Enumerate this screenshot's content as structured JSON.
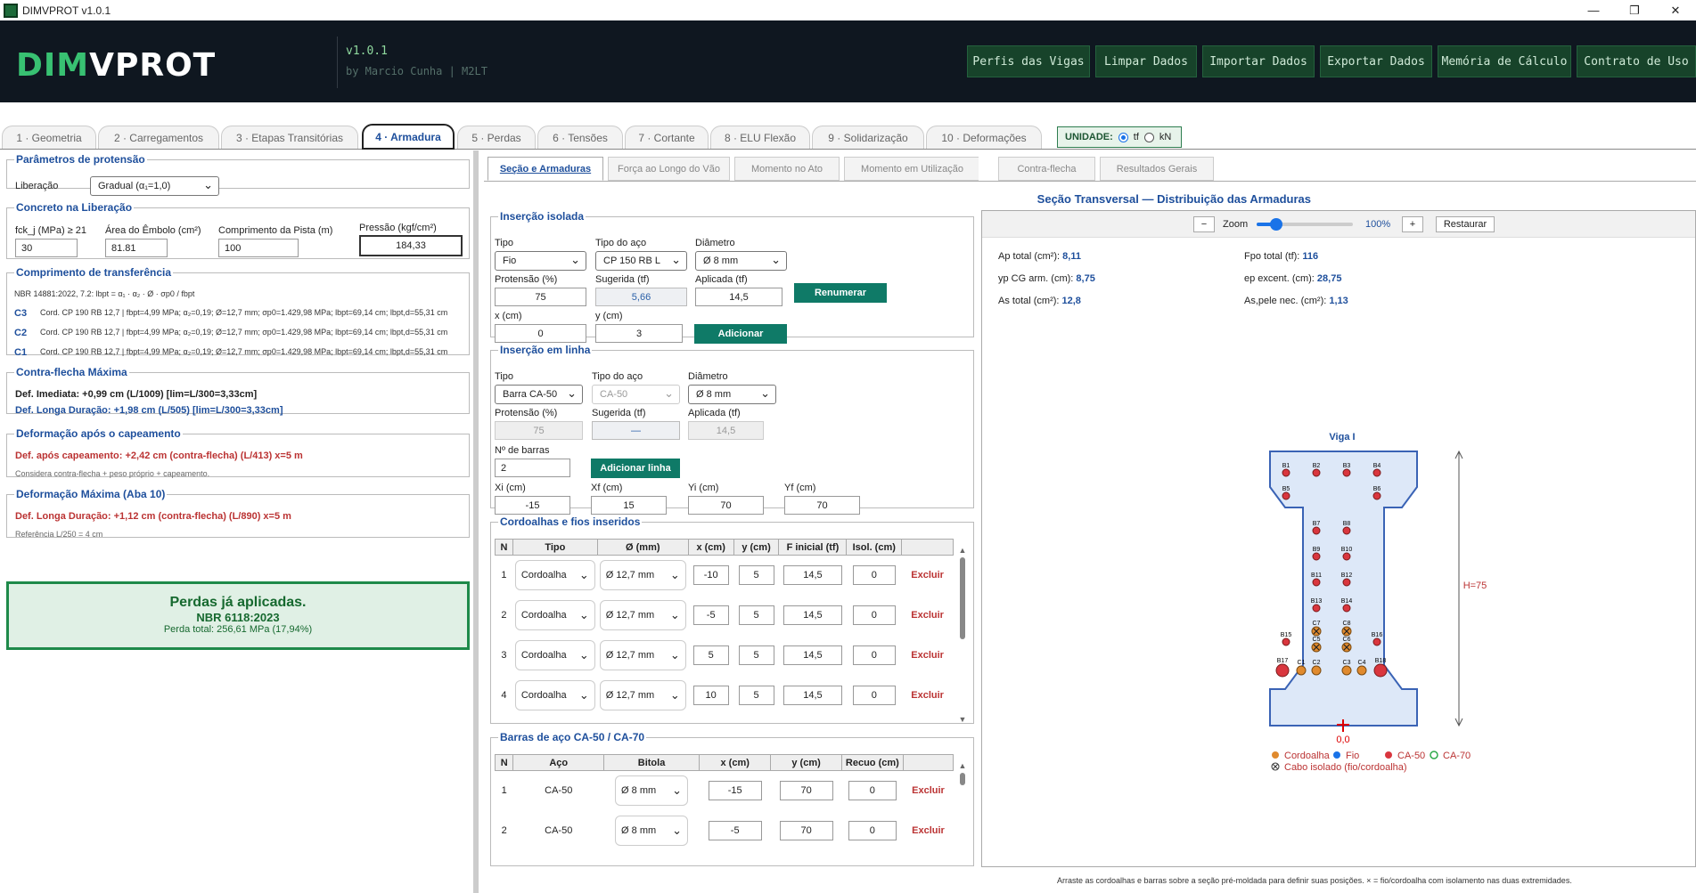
{
  "window": {
    "title": "DIMVPROT v1.0.1"
  },
  "header": {
    "logo_left": "DIM",
    "logo_right": "VPROT",
    "version": "v1.0.1",
    "byline": "by Marcio Cunha  |  M2LT",
    "buttons": [
      "Perfis das Vigas",
      "Limpar Dados",
      "Importar Dados",
      "Exportar Dados",
      "Memória de Cálculo",
      "Contrato de Uso"
    ]
  },
  "tabs": [
    "1 · Geometria",
    "2 · Carregamentos",
    "3 · Etapas Transitórias",
    "4 · Armadura",
    "5 · Perdas",
    "6 · Tensões",
    "7 · Cortante",
    "8 · ELU Flexão",
    "9 · Solidarização",
    "10 · Deformações"
  ],
  "unidade": {
    "label": "UNIDADE:",
    "opt1": "tf",
    "opt2": "kN"
  },
  "left": {
    "protensao": {
      "legend": "Parâmetros de protensão",
      "label": "Liberação",
      "value": "Gradual (α₁=1,0)"
    },
    "concreto": {
      "legend": "Concreto na Liberação",
      "fck_label": "fck_j (MPa) ≥ 21",
      "fck": "30",
      "area_label": "Área do Êmbolo (cm²)",
      "area": "81.81",
      "comp_label": "Comprimento da Pista (m)",
      "comp": "100",
      "pressao_label": "Pressão (kgf/cm²)",
      "pressao": "184,33"
    },
    "transfer": {
      "legend": "Comprimento de transferência",
      "norma": "NBR 14881:2022, 7.2: lbpt = α₁ · α₂ · Ø · σp0 / fbpt",
      "rows": [
        {
          "id": "C3",
          "text": "Cord. CP 190 RB 12,7 | fbpt=4,99 MPa; α₂=0,19; Ø=12,7 mm; σp0=1.429,98 MPa; lbpt=69,14 cm; lbpt,d=55,31 cm"
        },
        {
          "id": "C2",
          "text": "Cord. CP 190 RB 12,7 | fbpt=4,99 MPa; α₂=0,19; Ø=12,7 mm; σp0=1.429,98 MPa; lbpt=69,14 cm; lbpt,d=55,31 cm"
        },
        {
          "id": "C1",
          "text": "Cord. CP 190 RB 12,7 | fbpt=4,99 MPa; α₂=0,19; Ø=12,7 mm; σp0=1.429,98 MPa; lbpt=69,14 cm; lbpt,d=55,31 cm"
        }
      ]
    },
    "contraflecha": {
      "legend": "Contra-flecha Máxima",
      "line1": "Def. Imediata: +0,99 cm (L/1009) [lim=L/300=3,33cm]",
      "line2": "Def. Longa Duração: +1,98 cm (L/505) [lim=L/300=3,33cm]"
    },
    "capeamento": {
      "legend": "Deformação após o capeamento",
      "line1": "Def. após capeamento: +2,42 cm (contra-flecha) (L/413) x=5 m",
      "note": "Considera contra-flecha + peso próprio + capeamento."
    },
    "defmax": {
      "legend": "Deformação Máxima (Aba 10)",
      "line1": "Def. Longa Duração: +1,12 cm (contra-flecha) (L/890) x=5 m",
      "note": "Referência L/250 = 4 cm"
    },
    "perdas": {
      "title": "Perdas já aplicadas.",
      "norma": "NBR 6118:2023",
      "total": "Perda total: 256,61 MPa (17,94%)"
    }
  },
  "subtabs": [
    "Seção e Armaduras",
    "Força ao Longo do Vão",
    "Momento no Ato",
    "Momento em Utilização",
    "Contra-flecha",
    "Resultados Gerais"
  ],
  "isolada": {
    "legend": "Inserção isolada",
    "tipo_label": "Tipo",
    "tipo": "Fio",
    "aco_label": "Tipo do aço",
    "aco": "CP 150 RB L",
    "diam_label": "Diâmetro",
    "diam": "Ø 8 mm",
    "prot_label": "Protensão (%)",
    "prot": "75",
    "sug_label": "Sugerida (tf)",
    "sug": "5,66",
    "apl_label": "Aplicada (tf)",
    "apl": "14,5",
    "renumerar": "Renumerar",
    "x_label": "x (cm)",
    "x": "0",
    "y_label": "y (cm)",
    "y": "3",
    "adicionar": "Adicionar"
  },
  "linha": {
    "legend": "Inserção em linha",
    "tipo_label": "Tipo",
    "tipo": "Barra CA-50",
    "aco_label": "Tipo do aço",
    "aco": "CA-50",
    "diam_label": "Diâmetro",
    "diam": "Ø 8 mm",
    "prot_label": "Protensão (%)",
    "prot": "75",
    "sug_label": "Sugerida (tf)",
    "sug": "—",
    "apl_label": "Aplicada (tf)",
    "apl": "14,5",
    "nbar_label": "Nº de barras",
    "nbar": "2",
    "adicionar": "Adicionar linha",
    "xi_label": "Xi (cm)",
    "xi": "-15",
    "xf_label": "Xf (cm)",
    "xf": "15",
    "yi_label": "Yi (cm)",
    "yi": "70",
    "yf_label": "Yf (cm)",
    "yf": "70"
  },
  "cordoalhas": {
    "legend": "Cordoalhas e fios inseridos",
    "headers": [
      "N",
      "Tipo",
      "Ø (mm)",
      "x (cm)",
      "y (cm)",
      "F inicial (tf)",
      "Isol. (cm)",
      ""
    ],
    "rows": [
      {
        "n": "1",
        "tipo": "Cordoalha",
        "d": "Ø 12,7 mm",
        "x": "-10",
        "y": "5",
        "f": "14,5",
        "isol": "0",
        "del": "Excluir"
      },
      {
        "n": "2",
        "tipo": "Cordoalha",
        "d": "Ø 12,7 mm",
        "x": "-5",
        "y": "5",
        "f": "14,5",
        "isol": "0",
        "del": "Excluir"
      },
      {
        "n": "3",
        "tipo": "Cordoalha",
        "d": "Ø 12,7 mm",
        "x": "5",
        "y": "5",
        "f": "14,5",
        "isol": "0",
        "del": "Excluir"
      },
      {
        "n": "4",
        "tipo": "Cordoalha",
        "d": "Ø 12,7 mm",
        "x": "10",
        "y": "5",
        "f": "14,5",
        "isol": "0",
        "del": "Excluir"
      }
    ]
  },
  "barras": {
    "legend": "Barras de aço CA-50 / CA-70",
    "headers": [
      "N",
      "Aço",
      "Bitola",
      "x (cm)",
      "y (cm)",
      "Recuo (cm)",
      ""
    ],
    "rows": [
      {
        "n": "1",
        "aco": "CA-50",
        "b": "Ø 8 mm",
        "x": "-15",
        "y": "70",
        "r": "0",
        "del": "Excluir"
      },
      {
        "n": "2",
        "aco": "CA-50",
        "b": "Ø 8 mm",
        "x": "-5",
        "y": "70",
        "r": "0",
        "del": "Excluir"
      }
    ]
  },
  "section": {
    "title": "Seção Transversal — Distribuição das Armaduras",
    "zoom_minus": "−",
    "zoom_label": "Zoom",
    "zoom_value": "100%",
    "zoom_plus": "+",
    "restaurar": "Restaurar",
    "zoom_level": 0.2,
    "stats": {
      "ap": "Ap total (cm²):",
      "ap_v": "8,11",
      "fpo": "Fpo total (tf):",
      "fpo_v": "116",
      "yp": "yp CG arm. (cm):",
      "yp_v": "8,75",
      "ep": "ep excent. (cm):",
      "ep_v": "28,75",
      "as": "As total (cm²):",
      "as_v": "12,8",
      "aspele": "As,pele nec. (cm²):",
      "aspele_v": "1,13"
    },
    "viga": "Viga I",
    "h": "H=75",
    "origin": "0,0",
    "legend": {
      "cord": "Cordoalha",
      "fio": "Fio",
      "ca50": "CA-50",
      "ca70": "CA-70",
      "isolado": "Cabo isolado (fio/cordoalha)"
    },
    "bars": [
      "B1",
      "B2",
      "B3",
      "B4",
      "B5",
      "B6",
      "B7",
      "B8",
      "B9",
      "B10",
      "B11",
      "B12",
      "B13",
      "B14",
      "B15",
      "B16",
      "B17",
      "B18"
    ],
    "cables": [
      "C1",
      "C2",
      "C3",
      "C4",
      "C5",
      "C6",
      "C7",
      "C8"
    ],
    "footer": "Arraste as cordoalhas e barras sobre a seção pré-moldada para definir suas posições. × = fio/cordoalha com isolamento nas duas extremidades."
  },
  "colors": {
    "accent": "#1e4f9c",
    "green": "#0f7a67",
    "red": "#b33",
    "cordoalha": "#e08a2e",
    "ca50": "#d9363e"
  }
}
